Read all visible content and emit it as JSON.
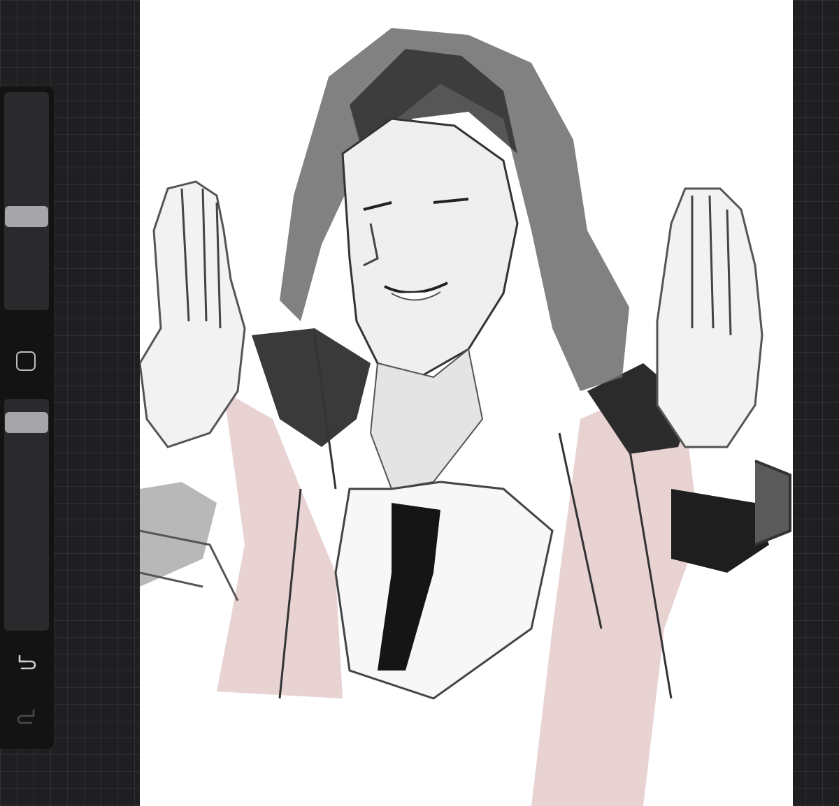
{
  "app": {
    "background_color": "#1f1f21",
    "canvas_color": "#ffffff",
    "accent_pink": "#e6cfcf"
  },
  "sidebar": {
    "brush_size_slider": {
      "level": 0.42
    },
    "modify_button": {
      "icon": "square-icon"
    },
    "opacity_slider": {
      "level": 0.95
    },
    "undo": {
      "icon": "undo-arrow-icon",
      "enabled": true
    },
    "redo": {
      "icon": "redo-arrow-icon",
      "enabled": false
    }
  },
  "canvas": {
    "artwork": {
      "subject": "sketch-portrait"
    }
  }
}
